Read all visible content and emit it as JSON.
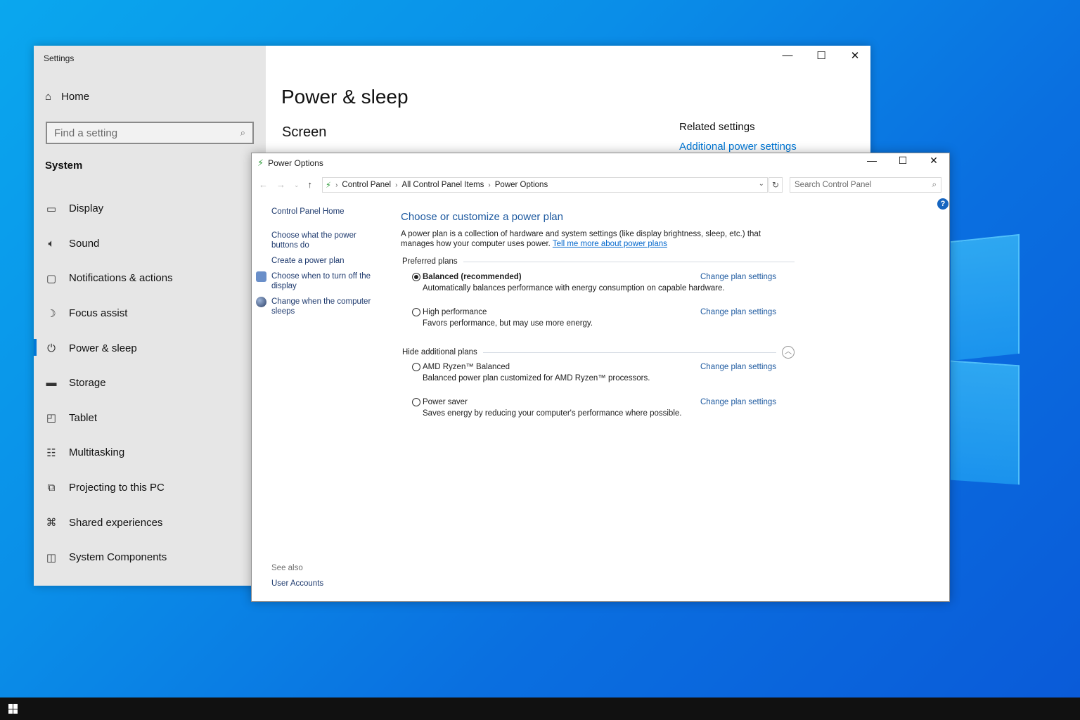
{
  "settings": {
    "window_title": "Settings",
    "home_label": "Home",
    "search_placeholder": "Find a setting",
    "section_label": "System",
    "nav_items": [
      {
        "label": "Display",
        "icon": "monitor-icon"
      },
      {
        "label": "Sound",
        "icon": "speaker-icon"
      },
      {
        "label": "Notifications & actions",
        "icon": "notification-icon"
      },
      {
        "label": "Focus assist",
        "icon": "moon-icon"
      },
      {
        "label": "Power & sleep",
        "icon": "power-icon",
        "active": true
      },
      {
        "label": "Storage",
        "icon": "storage-icon"
      },
      {
        "label": "Tablet",
        "icon": "tablet-icon"
      },
      {
        "label": "Multitasking",
        "icon": "multitasking-icon"
      },
      {
        "label": "Projecting to this PC",
        "icon": "projecting-icon"
      },
      {
        "label": "Shared experiences",
        "icon": "shared-icon"
      },
      {
        "label": "System Components",
        "icon": "components-icon"
      }
    ],
    "page_title": "Power & sleep",
    "screen_heading": "Screen",
    "related_heading": "Related settings",
    "related_link": "Additional power settings",
    "accent": "#0078d7"
  },
  "power_options": {
    "window_title": "Power Options",
    "breadcrumb": [
      "Control Panel",
      "All Control Panel Items",
      "Power Options"
    ],
    "search_placeholder": "Search Control Panel",
    "left_links": [
      "Control Panel Home",
      "Choose what the power buttons do",
      "Create a power plan",
      "Choose when to turn off the display",
      "Change when the computer sleeps"
    ],
    "see_also_label": "See also",
    "see_also_links": [
      "User Accounts"
    ],
    "heading": "Choose or customize a power plan",
    "description": "A power plan is a collection of hardware and system settings (like display brightness, sleep, etc.) that manages how your computer uses power.",
    "learn_more": "Tell me more about power plans",
    "preferred_label": "Preferred plans",
    "additional_label": "Hide additional plans",
    "change_label": "Change plan settings",
    "preferred_plans": [
      {
        "name": "Balanced (recommended)",
        "desc": "Automatically balances performance with energy consumption on capable hardware.",
        "selected": true
      },
      {
        "name": "High performance",
        "desc": "Favors performance, but may use more energy.",
        "selected": false
      }
    ],
    "additional_plans": [
      {
        "name": "AMD Ryzen™ Balanced",
        "desc": "Balanced power plan customized for AMD Ryzen™ processors.",
        "selected": false
      },
      {
        "name": "Power saver",
        "desc": "Saves energy by reducing your computer's performance where possible.",
        "selected": false
      }
    ]
  }
}
